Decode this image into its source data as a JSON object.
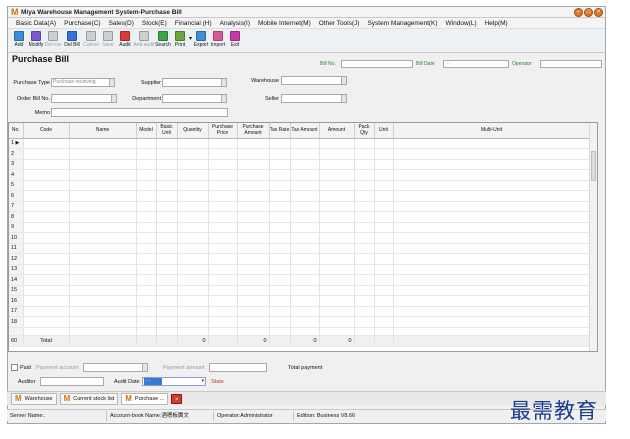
{
  "window": {
    "title": "Miya Warehouse Management System-Purchase Bill"
  },
  "menu": [
    "Basic Data(A)",
    "Purchase(C)",
    "Sales(D)",
    "Stock(E)",
    "Financial (H)",
    "Analysis(I)",
    "Mobile Internet(M)",
    "Other Tools(J)",
    "System Management(K)",
    "Window(L)",
    "Help(M)"
  ],
  "toolbar": [
    {
      "label": "Add",
      "icon": "add-icon",
      "color": "#3a8fd8",
      "enabled": true
    },
    {
      "label": "Modify",
      "icon": "modify-icon",
      "color": "#7b5bd0",
      "enabled": true
    },
    {
      "label": "Del row",
      "icon": "delete-row-icon",
      "color": "#cfcfcf",
      "enabled": false
    },
    {
      "label": "Del Bill",
      "icon": "delete-bill-icon",
      "color": "#3a6fd8",
      "enabled": true
    },
    {
      "label": "Cancel",
      "icon": "cancel-icon",
      "color": "#cfcfcf",
      "enabled": false
    },
    {
      "label": "Save",
      "icon": "save-icon",
      "color": "#cfcfcf",
      "enabled": false
    },
    {
      "label": "Audit",
      "icon": "audit-icon",
      "color": "#d93a3a",
      "enabled": true
    },
    {
      "label": "Anti-audit",
      "icon": "anti-audit-icon",
      "color": "#cfcfcf",
      "enabled": false
    },
    {
      "label": "Search",
      "icon": "search-icon",
      "color": "#3aa84a",
      "enabled": true
    },
    {
      "label": "Print",
      "icon": "print-icon",
      "color": "#6aa83a",
      "enabled": true
    },
    {
      "label": "Export",
      "icon": "export-icon",
      "color": "#3a8fd8",
      "enabled": true
    },
    {
      "label": "Import",
      "icon": "import-icon",
      "color": "#d85a9a",
      "enabled": true
    },
    {
      "label": "Exit",
      "icon": "exit-icon",
      "color": "#c83aa8",
      "enabled": true
    }
  ],
  "header": {
    "page_title": "Purchase Bill",
    "bill_no_label": "Bill No.",
    "bill_date_label": "Bill Date",
    "bill_date_value": "- -",
    "operator_label": "Operator"
  },
  "form": {
    "purchase_type_label": "Purchase Type",
    "purchase_type_value": "Purchase receiving",
    "supplier_label": "Supplier",
    "warehouse_label": "Warehouse",
    "order_bill_label": "Order Bill No.",
    "department_label": "Department",
    "seller_label": "Seller",
    "memo_label": "Memo"
  },
  "grid": {
    "columns": [
      "No.",
      "Code",
      "Name",
      "Model",
      "Basic Unit",
      "Quantity",
      "Purchase Price",
      "Purchase Amount",
      "Tax Rate",
      "Tax Amount",
      "Amount",
      "Pack Qty",
      "Unit",
      "Multi-Unit"
    ],
    "row_numbers": [
      "1",
      "2",
      "3",
      "4",
      "5",
      "6",
      "7",
      "8",
      "9",
      "10",
      "11",
      "12",
      "13",
      "14",
      "15",
      "16",
      "17",
      "18"
    ],
    "total": {
      "row_number": "60",
      "label": "Total",
      "quantity": "0",
      "purchase_amount": "0",
      "tax_amount": "0",
      "amount": "0"
    }
  },
  "footer": {
    "paid_label": "Paid",
    "payment_account_label": "Payment account",
    "payment_amount_label": "Payment amount",
    "total_payment_label": "Total payment",
    "auditor_label": "Auditor",
    "audit_date_label": "Audit Date",
    "audit_date_value": "- -",
    "state_label": "State"
  },
  "taskbar": [
    "Warehouse",
    "Current stock list",
    "Purchase ..."
  ],
  "statusbar": {
    "server": "Server Name:.",
    "account_book": "Account-book Name:酒嗯板厲文",
    "operator": "Operator:Administrator",
    "edition": "Edition:  Business V8.66"
  },
  "watermark": "最需教育"
}
